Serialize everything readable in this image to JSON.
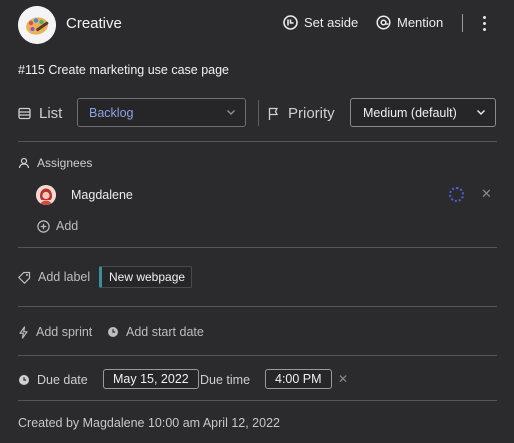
{
  "header": {
    "title": "Creative",
    "set_aside_label": "Set aside",
    "mention_label": "Mention"
  },
  "task": {
    "title": "#115 Create marketing use case page"
  },
  "list_field": {
    "label": "List",
    "value": "Backlog"
  },
  "priority_field": {
    "label": "Priority",
    "value": "Medium (default)"
  },
  "assignees": {
    "label": "Assignees",
    "users": [
      {
        "name": "Magdalene"
      }
    ],
    "add_label": "Add"
  },
  "labels": {
    "add_label": "Add label",
    "tags": [
      {
        "text": "New webpage",
        "color": "#3b8ea0"
      }
    ]
  },
  "sprint": {
    "add_sprint_label": "Add sprint",
    "add_start_date_label": "Add start date"
  },
  "due": {
    "due_date_label": "Due date",
    "due_date_value": "May 15, 2022",
    "due_time_label": "Due time",
    "due_time_value": "4:00 PM"
  },
  "footer": {
    "created_text": "Created by Magdalene 10:00 am April 12, 2022"
  },
  "colors": {
    "background": "#2b2b2d",
    "accent_list": "#8ea3e2",
    "spinner": "#4a63d6",
    "tag_accent": "#3b8ea0"
  },
  "icons": [
    "palette-icon",
    "set-aside-icon",
    "mention-icon",
    "more-vertical-icon",
    "list-icon",
    "chevron-down-icon",
    "flag-icon",
    "user-icon",
    "plus-circle-icon",
    "tag-icon",
    "bolt-icon",
    "clock-icon",
    "close-icon",
    "loading-icon"
  ]
}
